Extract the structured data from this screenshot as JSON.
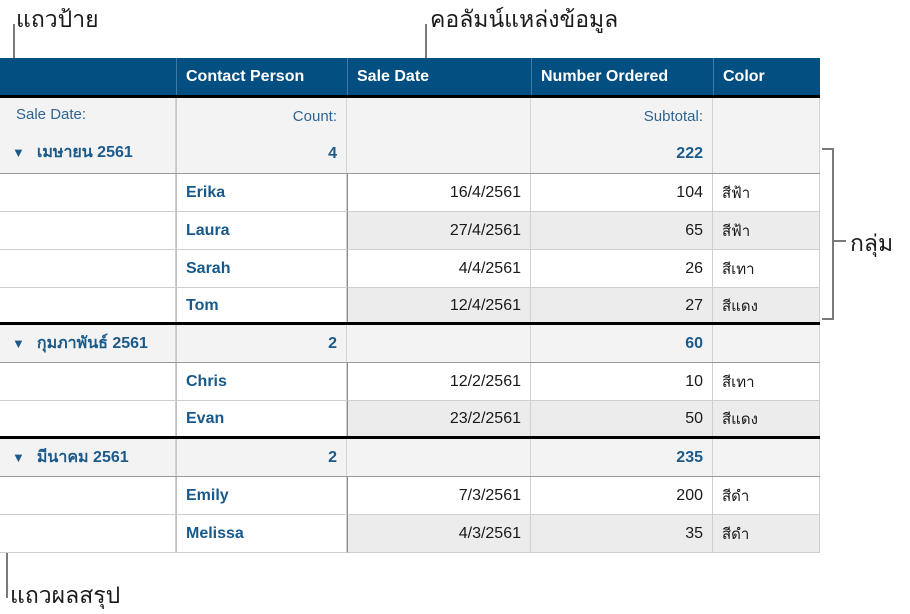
{
  "callouts": {
    "header_row": "แถวป้าย",
    "source_column": "คอลัมน์แหล่งข้อมูล",
    "group": "กลุ่ม",
    "summary_row": "แถวผลสรุป"
  },
  "table": {
    "headers": [
      "",
      "Contact Person",
      "Sale Date",
      "Number Ordered",
      "Color"
    ],
    "label_row": {
      "group_label": "Sale Date:",
      "count_label": "Count:",
      "subtotal_label": "Subtotal:"
    },
    "groups": [
      {
        "name": "เมษายน 2561",
        "count": "4",
        "subtotal": "222",
        "rows": [
          {
            "person": "Erika",
            "date": "16/4/2561",
            "ordered": "104",
            "color": "สีฟ้า"
          },
          {
            "person": "Laura",
            "date": "27/4/2561",
            "ordered": "65",
            "color": "สีฟ้า"
          },
          {
            "person": "Sarah",
            "date": "4/4/2561",
            "ordered": "26",
            "color": "สีเทา"
          },
          {
            "person": "Tom",
            "date": "12/4/2561",
            "ordered": "27",
            "color": "สีแดง"
          }
        ]
      },
      {
        "name": "กุมภาพันธ์ 2561",
        "count": "2",
        "subtotal": "60",
        "rows": [
          {
            "person": "Chris",
            "date": "12/2/2561",
            "ordered": "10",
            "color": "สีเทา"
          },
          {
            "person": "Evan",
            "date": "23/2/2561",
            "ordered": "50",
            "color": "สีแดง"
          }
        ]
      },
      {
        "name": "มีนาคม 2561",
        "count": "2",
        "subtotal": "235",
        "rows": [
          {
            "person": "Emily",
            "date": "7/3/2561",
            "ordered": "200",
            "color": "สีดำ"
          },
          {
            "person": "Melissa",
            "date": "4/3/2561",
            "ordered": "35",
            "color": "สีดำ"
          }
        ]
      }
    ],
    "collapse_icon": "disclosure-triangle-down"
  },
  "colors": {
    "header_bg": "#044f82",
    "accent_text": "#1b5a8a"
  }
}
